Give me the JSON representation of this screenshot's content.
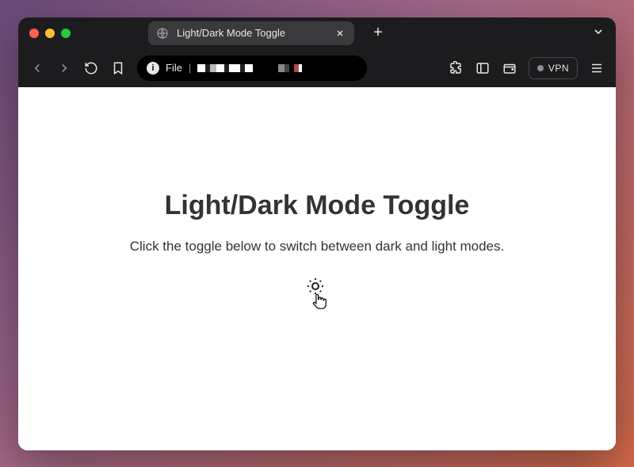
{
  "browser": {
    "tab_title": "Light/Dark Mode Toggle",
    "url_scheme": "File",
    "vpn_label": "VPN"
  },
  "page": {
    "title": "Light/Dark Mode Toggle",
    "subtitle": "Click the toggle below to switch between dark and light modes."
  }
}
